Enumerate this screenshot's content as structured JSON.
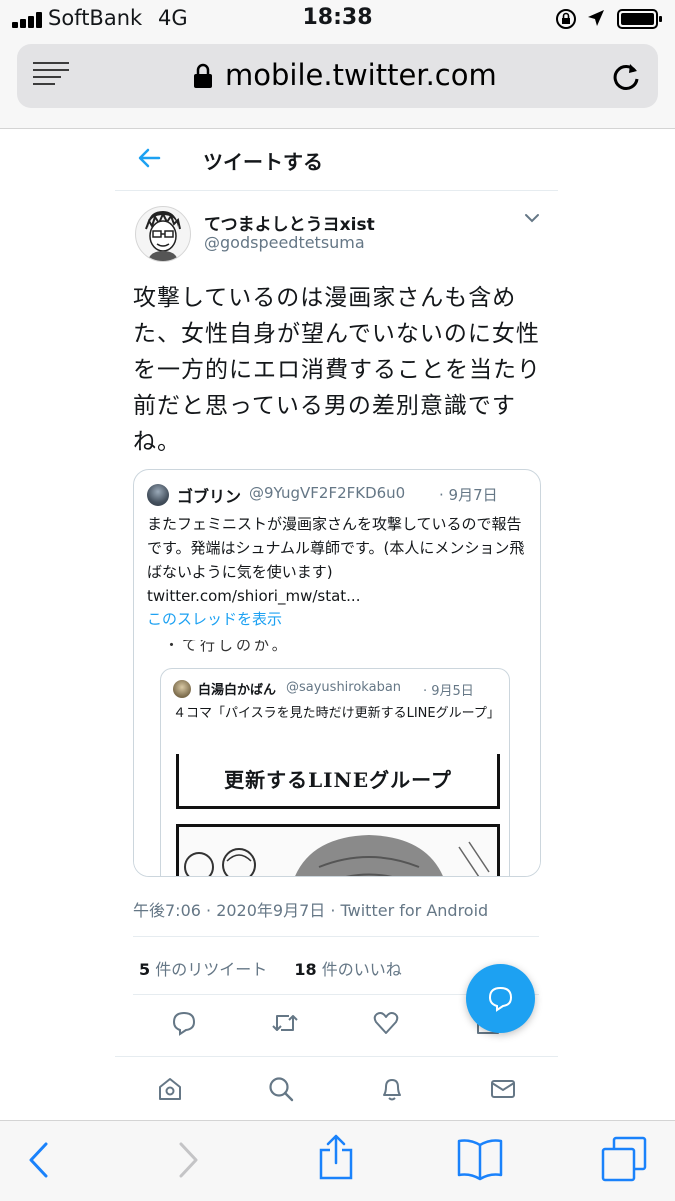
{
  "status_bar": {
    "carrier": "SoftBank",
    "network": "4G",
    "time": "18:38"
  },
  "browser": {
    "url": "mobile.twitter.com"
  },
  "header": {
    "title": "ツイートする"
  },
  "tweet": {
    "author_name": "てつまよしとうヨxist",
    "author_handle": "@godspeedtetsuma",
    "text": "攻撃しているのは漫画家さんも含めた、女性自身が望んでいないのに女性を一方的にエロ消費することを当たり前だと思っている男の差別意識ですね。",
    "timestamp": "午後7:06 · 2020年9月7日 · Twitter for Android",
    "retweet_count": "5",
    "retweet_label": "件のリツイート",
    "like_count": "18",
    "like_label": "件のいいね"
  },
  "quoted_tweet": {
    "author_name": "ゴブリン",
    "author_handle": "@9YugVF2F2FKD6u0",
    "date": "· 9月7日",
    "text": "またフェミニストが漫画家さんを攻撃しているので報告です。発端はシュナムル尊師です。(本人にメンション飛ばないように気を使います)\ntwitter.com/shiori_mw/stat...",
    "show_thread": "このスレッドを表示",
    "cut_text": "・て行しのか。"
  },
  "nested_quote": {
    "author_name": "白湯白かばん",
    "author_handle": "@sayushirokaban",
    "date": "· 9月5日",
    "text": "４コマ「パイスラを見た時だけ更新するLINEグループ」",
    "manga_title": "更新するLINEグループ"
  },
  "icons": [
    "back-arrow-icon",
    "chevron-down-icon",
    "reply-icon",
    "retweet-icon",
    "like-icon",
    "share-icon",
    "compose-icon",
    "home-icon",
    "search-icon",
    "notifications-icon",
    "messages-icon"
  ],
  "colors": {
    "accent": "#1da1f2",
    "secondary_text": "#657786",
    "border": "#e6ecf0"
  }
}
